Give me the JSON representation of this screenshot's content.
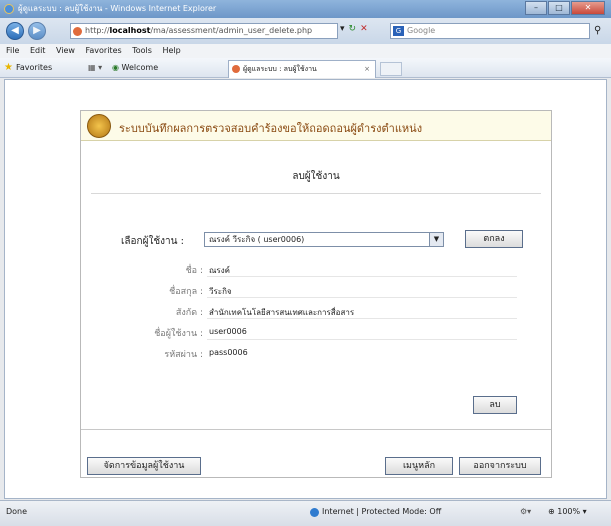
{
  "window": {
    "title": "ผู้ดูแลระบบ : ลบผู้ใช้งาน - Windows Internet Explorer",
    "buttons": [
      "–",
      "□",
      "✕"
    ]
  },
  "address_bar": {
    "url_prefix": "http://",
    "url_host": "localhost",
    "url_path": "/ma/assessment/admin_user_delete.php",
    "search_provider": "G",
    "search_placeholder": "Google"
  },
  "menu": [
    "File",
    "Edit",
    "View",
    "Favorites",
    "Tools",
    "Help"
  ],
  "favorites_bar": {
    "label": "Favorites",
    "welcome": "Welcome",
    "tab_title": "ผู้ดูแลระบบ : ลบผู้ใช้งาน",
    "tab_close": "×"
  },
  "page": {
    "system_title": "ระบบบันทึกผลการตรวจสอบคำร้องขอให้ถอดถอนผู้ดำรงตำแหน่ง",
    "heading": "ลบผู้ใช้งาน",
    "select_label": "เลือกผู้ใช้งาน :",
    "select_value": "ณรงค์ วีระกิจ ( user0006)",
    "ok_button": "ตกลง",
    "fields": [
      {
        "label": "ชื่อ :",
        "value": "ณรงค์"
      },
      {
        "label": "ชื่อสกุล :",
        "value": "วีระกิจ"
      },
      {
        "label": "สังกัด :",
        "value": "สำนักเทคโนโลยีสารสนเทศและการสื่อสาร"
      },
      {
        "label": "ชื่อผู้ใช้งาน :",
        "value": "user0006"
      },
      {
        "label": "รหัสผ่าน :",
        "value": "pass0006"
      }
    ],
    "delete_button": "ลบ",
    "manage_button": "จัดการข้อมูลผู้ใช้งาน",
    "main_menu_button": "เมนูหลัก",
    "logout_button": "ออกจากระบบ"
  },
  "status_bar": {
    "left": "Done",
    "zone": "Internet | Protected Mode: Off",
    "zoom": "100%"
  }
}
